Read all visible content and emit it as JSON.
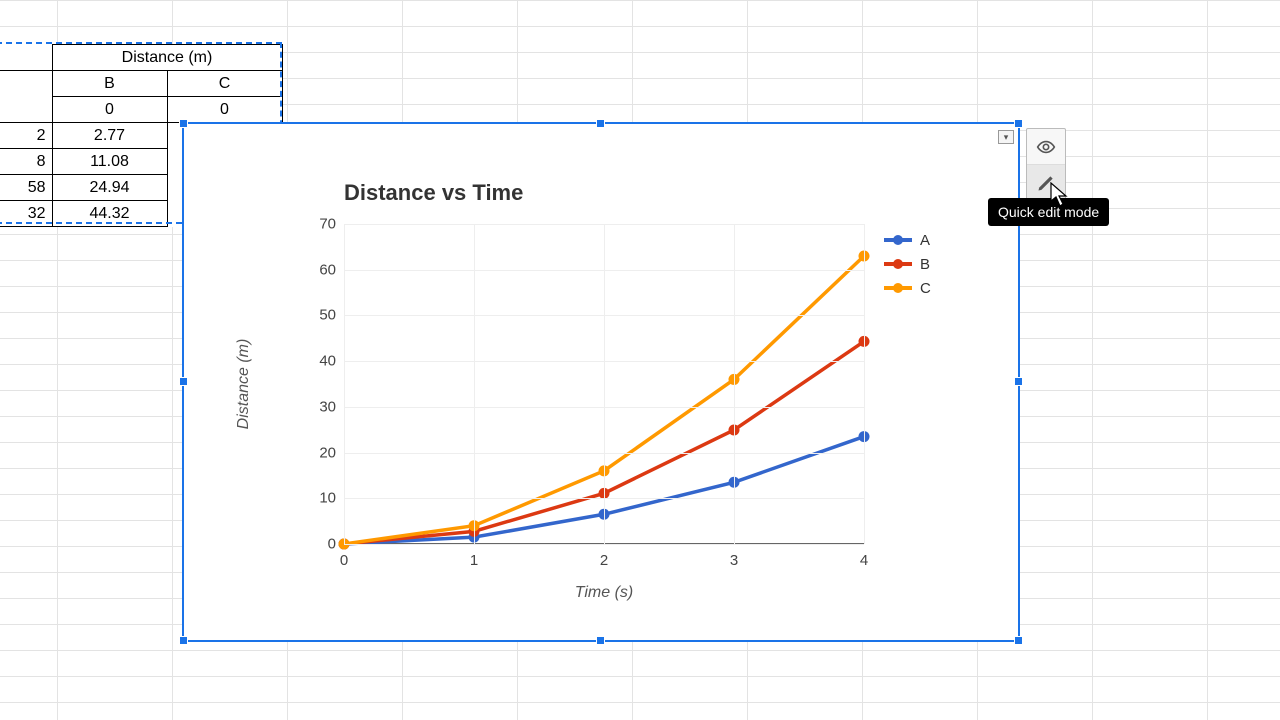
{
  "table": {
    "header_group": "Distance (m)",
    "cols": [
      "B",
      "C"
    ],
    "rows_visible": [
      {
        "a": "",
        "b": "0",
        "c": "0"
      },
      {
        "a": "2",
        "b": "2.77",
        "c": ""
      },
      {
        "a": "8",
        "b": "11.08",
        "c": ""
      },
      {
        "a": "58",
        "b": "24.94",
        "c": ""
      },
      {
        "a": "32",
        "b": "44.32",
        "c": ""
      }
    ]
  },
  "chart_data": {
    "type": "line",
    "title": "Distance vs Time",
    "xlabel": "Time (s)",
    "ylabel": "Distance (m)",
    "xlim": [
      0,
      4
    ],
    "ylim": [
      0,
      70
    ],
    "xticks": [
      0,
      1,
      2,
      3,
      4
    ],
    "yticks": [
      0,
      10,
      20,
      30,
      40,
      50,
      60,
      70
    ],
    "x": [
      0,
      1,
      2,
      3,
      4
    ],
    "series": [
      {
        "name": "A",
        "color": "#3366cc",
        "values": [
          0,
          1.5,
          6.5,
          13.5,
          23.5
        ]
      },
      {
        "name": "B",
        "color": "#dc3912",
        "values": [
          0,
          2.77,
          11.08,
          24.94,
          44.32
        ]
      },
      {
        "name": "C",
        "color": "#ff9900",
        "values": [
          0,
          4,
          16,
          36,
          63
        ]
      }
    ],
    "legend_position": "right"
  },
  "toolbar": {
    "view_label": "View mode",
    "edit_label": "Quick edit mode"
  },
  "tooltip_text": "Quick edit mode"
}
